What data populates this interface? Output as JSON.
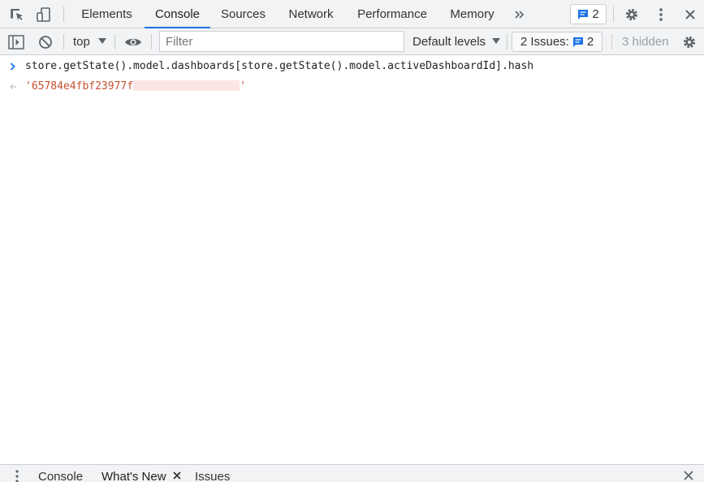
{
  "tabs": {
    "items": [
      "Elements",
      "Console",
      "Sources",
      "Network",
      "Performance",
      "Memory"
    ],
    "active": "Console",
    "overflow_icon": "double-chevron-right-icon"
  },
  "header": {
    "messages_count": "2"
  },
  "toolbar": {
    "context": "top",
    "filter_placeholder": "Filter",
    "levels": "Default levels",
    "issues_label": "2 Issues:",
    "issues_count": "2",
    "hidden": "3 hidden"
  },
  "console": {
    "command": "store.getState().model.dashboards[store.getState().model.activeDashboardId].hash",
    "result_prefix": "'65784e4fbf23977f",
    "result_suffix": "'"
  },
  "drawer": {
    "tabs": [
      "Console",
      "What's New",
      "Issues"
    ]
  },
  "colors": {
    "accent": "#1a73e8",
    "toolbar_bg": "#f1f3f4",
    "result_text": "#c5502f"
  }
}
